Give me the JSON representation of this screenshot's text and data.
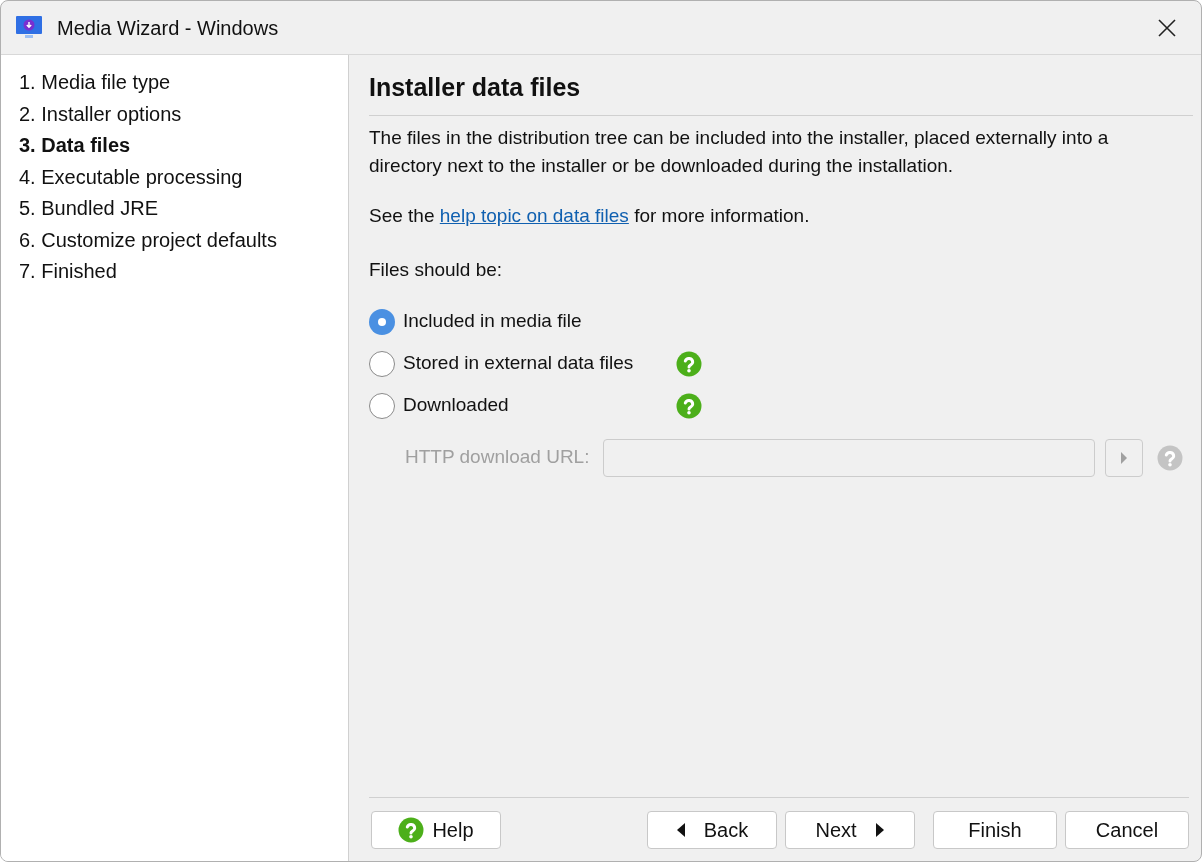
{
  "window": {
    "title": "Media Wizard - Windows"
  },
  "steps": [
    {
      "label": "1. Media file type",
      "selected": false
    },
    {
      "label": "2. Installer options",
      "selected": false
    },
    {
      "label": "3. Data files",
      "selected": true
    },
    {
      "label": "4. Executable processing",
      "selected": false
    },
    {
      "label": "5. Bundled JRE",
      "selected": false
    },
    {
      "label": "6. Customize project defaults",
      "selected": false
    },
    {
      "label": "7. Finished",
      "selected": false
    }
  ],
  "page": {
    "heading": "Installer data files",
    "description": "The files in the distribution tree can be included into the installer, placed externally into a directory next to the installer or be downloaded during the installation.",
    "help_sentence": {
      "before": "See the ",
      "link": "help topic on data files",
      "after": " for more information."
    },
    "group_label": "Files should be:",
    "options": [
      {
        "label": "Included in media file",
        "selected": true,
        "help": false
      },
      {
        "label": "Stored in external data files",
        "selected": false,
        "help": true
      },
      {
        "label": "Downloaded",
        "selected": false,
        "help": true
      }
    ],
    "url_field": {
      "label": "HTTP download URL:",
      "disabled": true
    }
  },
  "buttons": [
    {
      "label": "Help",
      "kind": "help"
    },
    {
      "label": "Back",
      "kind": "back"
    },
    {
      "label": "Next",
      "kind": "next"
    },
    {
      "label": "Finish",
      "kind": "plain"
    },
    {
      "label": "Cancel",
      "kind": "plain"
    }
  ]
}
